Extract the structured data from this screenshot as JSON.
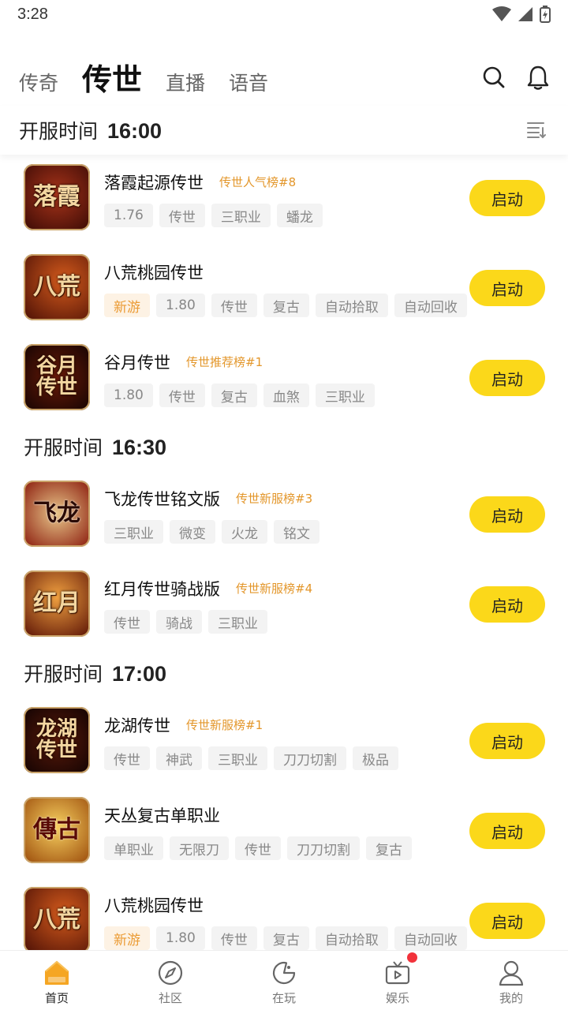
{
  "status_bar": {
    "time": "3:28"
  },
  "top_tabs": [
    {
      "label": "传奇",
      "active": false
    },
    {
      "label": "传世",
      "active": true
    },
    {
      "label": "直播",
      "active": false
    },
    {
      "label": "语音",
      "active": false
    }
  ],
  "top_icons": [
    "search-icon",
    "bell-icon"
  ],
  "sticky_header": {
    "label": "开服时间",
    "time": "16:00",
    "icon": "sort-icon"
  },
  "sections": [
    {
      "label": "开服时间",
      "time": "16:30"
    },
    {
      "label": "开服时间",
      "time": "17:00"
    }
  ],
  "games": [
    {
      "icon_text": "落霞",
      "icon_color": "#5a1208",
      "name": "落霞起源传世",
      "rank": "传世人气榜#8",
      "tags": [
        "1.76",
        "传世",
        "三职业",
        "蟠龙"
      ],
      "new": false,
      "button": "启动"
    },
    {
      "icon_text": "八荒",
      "icon_color": "#6b1b0c",
      "name": "八荒桃园传世",
      "rank": "",
      "tags": [
        "新游",
        "1.80",
        "传世",
        "复古",
        "自动拾取",
        "自动回收"
      ],
      "new": true,
      "button": "启动"
    },
    {
      "icon_text": "谷月传世",
      "icon_color": "#3a0d05",
      "name": "谷月传世",
      "rank": "传世推荐榜#1",
      "tags": [
        "1.80",
        "传世",
        "复古",
        "血煞",
        "三职业"
      ],
      "new": false,
      "button": "启动"
    },
    {
      "icon_text": "飞龙",
      "icon_color": "#7a1c10",
      "name": "飞龙传世铭文版",
      "rank": "传世新服榜#3",
      "tags": [
        "三职业",
        "微变",
        "火龙",
        "铭文"
      ],
      "new": false,
      "button": "启动"
    },
    {
      "icon_text": "红月",
      "icon_color": "#8a2a0e",
      "name": "红月传世骑战版",
      "rank": "传世新服榜#4",
      "tags": [
        "传世",
        "骑战",
        "三职业"
      ],
      "new": false,
      "button": "启动"
    },
    {
      "icon_text": "龙湖传世",
      "icon_color": "#2a0a04",
      "name": "龙湖传世",
      "rank": "传世新服榜#1",
      "tags": [
        "传世",
        "神武",
        "三职业",
        "刀刀切割",
        "极品"
      ],
      "new": false,
      "button": "启动"
    },
    {
      "icon_text": "傳古",
      "icon_color": "#a0520e",
      "name": "天丛复古单职业",
      "rank": "",
      "tags": [
        "单职业",
        "无限刀",
        "传世",
        "刀刀切割",
        "复古"
      ],
      "new": false,
      "button": "启动"
    },
    {
      "icon_text": "八荒",
      "icon_color": "#6b1b0c",
      "name": "八荒桃园传世",
      "rank": "",
      "tags": [
        "新游",
        "1.80",
        "传世",
        "复古",
        "自动拾取",
        "自动回收"
      ],
      "new": true,
      "button": "启动"
    }
  ],
  "bottom_nav": [
    {
      "label": "首页",
      "icon": "home-icon",
      "active": true
    },
    {
      "label": "社区",
      "icon": "compass-icon",
      "active": false
    },
    {
      "label": "在玩",
      "icon": "gamepad-icon",
      "active": false
    },
    {
      "label": "娱乐",
      "icon": "tv-icon",
      "active": false,
      "badge": true
    },
    {
      "label": "我的",
      "icon": "user-icon",
      "active": false
    }
  ],
  "colors": {
    "accent": "#fbd81a",
    "rank": "#e3962a",
    "new_tag": "#eb9b34",
    "badge": "#f2323b",
    "home_icon": "#f5a623"
  }
}
